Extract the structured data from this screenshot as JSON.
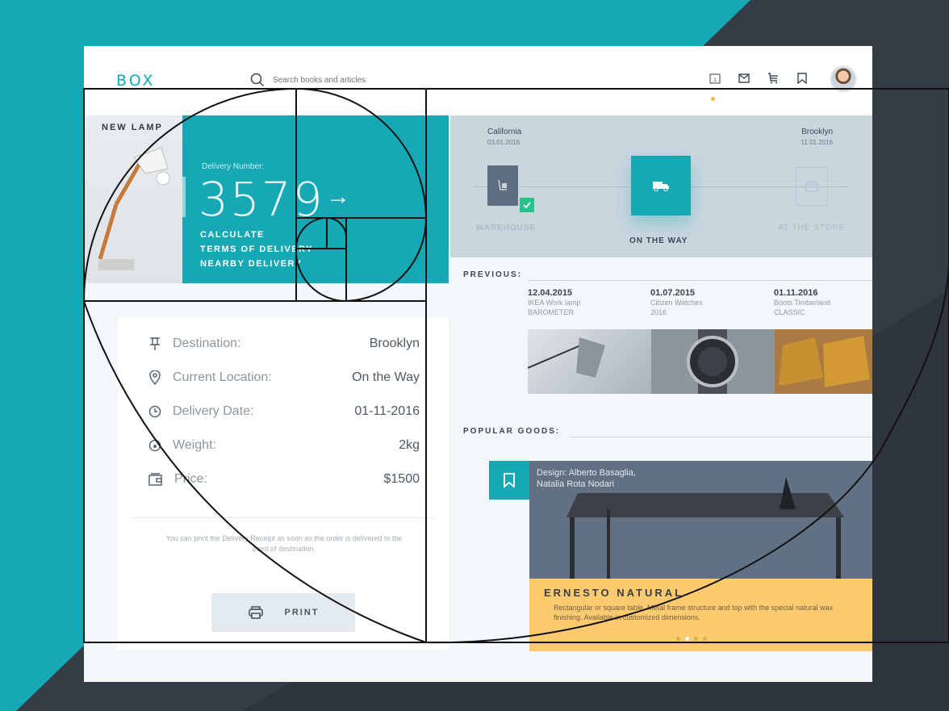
{
  "colors": {
    "teal": "#16a9b5",
    "slate": "#5f6d80",
    "yellow": "#fdca70",
    "dark_bg": "#343c46",
    "green_check": "#27c489"
  },
  "header": {
    "logo": "BOX",
    "search_placeholder": "Search books and articles",
    "icons": [
      "calendar-icon",
      "mail-icon",
      "cart-icon",
      "bookmark-icon"
    ],
    "calendar_number": "1"
  },
  "hero": {
    "product_label": "NEW LAMP",
    "delivery_label": "Delivery Number:",
    "delivery_number": "3579",
    "links": [
      "CALCULATE",
      "TERMS OF DELIVERY",
      "NEARBY DELIVERY"
    ]
  },
  "details": {
    "rows": [
      {
        "icon": "pin-icon",
        "label": "Destination:",
        "value": "Brooklyn"
      },
      {
        "icon": "location-icon",
        "label": "Current Location:",
        "value": "On the Way"
      },
      {
        "icon": "clock-icon",
        "label": "Delivery Date:",
        "value": "01-11-2016"
      },
      {
        "icon": "weight-icon",
        "label": "Weight:",
        "value": "2kg"
      },
      {
        "icon": "wallet-icon",
        "label": "Price:",
        "value": "$1500"
      }
    ],
    "note": "You can print the Delivery Receipt as soon as the order is delivered to the point of destination.",
    "print_label": "PRINT"
  },
  "tracker": {
    "origin": {
      "city": "California",
      "date": "03.01.2016"
    },
    "destination": {
      "city": "Brooklyn",
      "date": "11.01.2016"
    },
    "steps": [
      {
        "label": "WAREHOUSE",
        "state": "done"
      },
      {
        "label": "ON THE WAY",
        "state": "active"
      },
      {
        "label": "AT THE STORE",
        "state": "pending"
      }
    ]
  },
  "previous": {
    "title": "PREVIOUS:",
    "items": [
      {
        "date": "12.04.2015",
        "name": "IKEA Work lamp",
        "brand": "BAROMETER"
      },
      {
        "date": "01.07.2015",
        "name": "Citizen Watches",
        "brand": "2016"
      },
      {
        "date": "01.11.2016",
        "name": "Boots Timberland",
        "brand": "CLASSIC"
      }
    ]
  },
  "popular": {
    "title": "POPULAR GOODS:",
    "designer_line1": "Design: Alberto Basaglia,",
    "designer_line2": "Natalia Rota Nodari",
    "product_name": "ERNESTO NATURAL",
    "product_desc": "Rectangular or square table. Metal frame structure and top with the special natural wax finishing. Available in customized dimensions.",
    "slide_count": 4,
    "active_slide": 2
  }
}
